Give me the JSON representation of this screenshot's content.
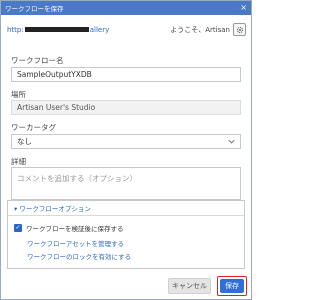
{
  "dialog": {
    "title": "ワークフローを保存",
    "close_glyph": "×"
  },
  "header": {
    "url_prefix": "http:",
    "url_suffix": "allery",
    "welcome_text": "ようこそ、Artisan"
  },
  "form": {
    "name_label": "ワークフロー名",
    "name_value": "SampleOutputYXDB",
    "location_label": "場所",
    "location_value": "Artisan User's Studio",
    "tag_label": "ワーカータグ",
    "tag_value": "なし",
    "details_label": "詳細",
    "details_placeholder": "コメントを追加する（オプション）"
  },
  "options": {
    "header": "▾ ワークフローオプション",
    "validate_checkbox_label": "ワークフローを検証後に保存する",
    "validate_checked": true,
    "manage_assets_link": "ワークフローアセットを管理する",
    "enable_lock_link": "ワークフローのロックを有効にする"
  },
  "buttons": {
    "cancel_label": "キャンセル",
    "save_label": "保存"
  },
  "colors": {
    "titlebar": "#4a79c8",
    "link": "#2b66c4",
    "primary_button": "#2f6fd6",
    "highlight_border": "#e02020"
  }
}
